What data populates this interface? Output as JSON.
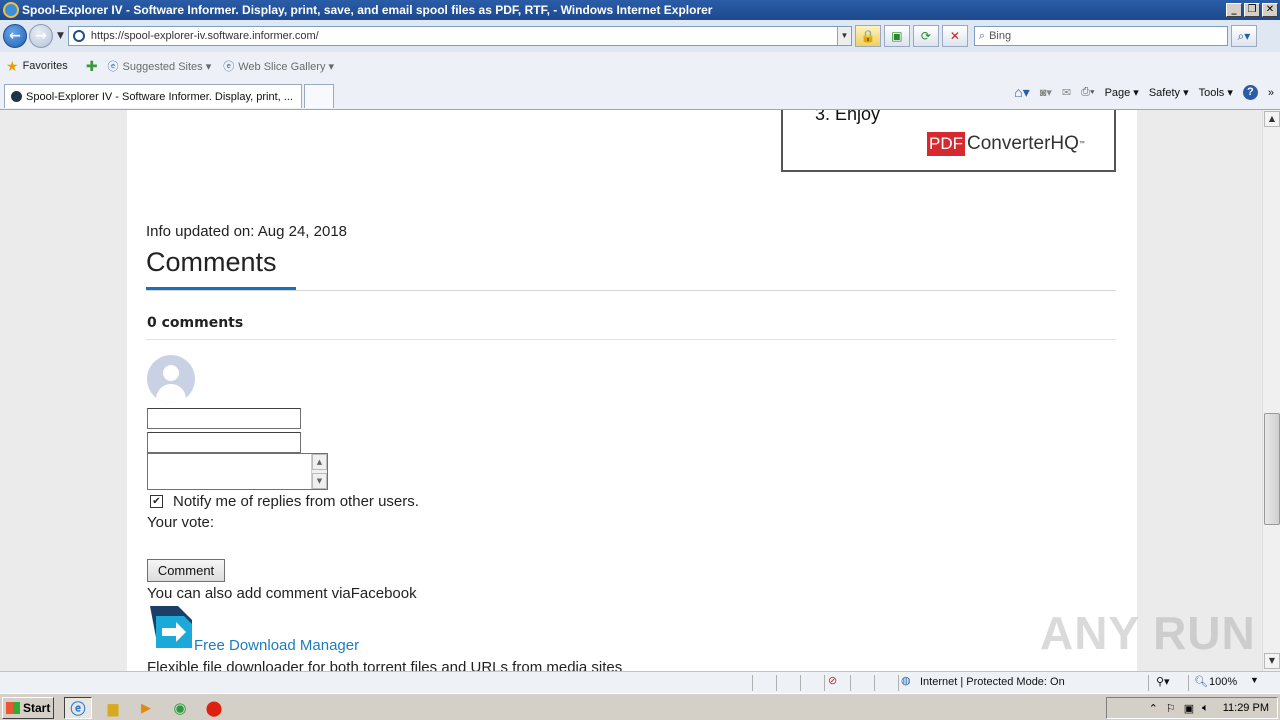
{
  "window": {
    "title": "Spool-Explorer IV - Software Informer. Display, print, save, and email spool files as PDF, RTF, - Windows Internet Explorer",
    "minimize": "_",
    "restore": "❐",
    "close": "✕"
  },
  "address": {
    "url": "https://spool-explorer-iv.software.informer.com/",
    "search_placeholder": "Bing"
  },
  "favorites": {
    "favorites_label": "Favorites",
    "suggested_sites": "Suggested Sites ▾",
    "web_slice_gallery": "Web Slice Gallery ▾"
  },
  "tabs": [
    {
      "label": "Spool-Explorer IV - Software Informer. Display, print, ..."
    }
  ],
  "command_bar": {
    "page": "Page ▾",
    "safety": "Safety ▾",
    "tools": "Tools ▾"
  },
  "ad": {
    "step": "3.  Enjoy",
    "logo_pdf": "PDF",
    "logo_text": "ConverterHQ",
    "logo_tm": "™"
  },
  "content": {
    "info_updated": "Info updated on: Aug 24, 2018",
    "comments_heading": "Comments",
    "comments_count": "0 comments",
    "notify_label": "Notify me of replies from other users.",
    "notify_checked": true,
    "your_vote": "Your vote:",
    "comment_button": "Comment",
    "facebook_line": "You can also add comment viaFacebook",
    "related_app_name": "Free Download Manager",
    "related_app_desc": "Flexible file downloader for both torrent files and URLs from media sites"
  },
  "status": {
    "zone": "Internet | Protected Mode: On",
    "zoom": "100%"
  },
  "taskbar": {
    "start": "Start",
    "clock": "11:29 PM"
  },
  "watermark": "ANY RUN",
  "colors": {
    "link": "#1b7dc0",
    "accent_underline": "#1b6fb8",
    "pdf_red": "#d6282f",
    "titlebar": "#2a5ca8"
  }
}
